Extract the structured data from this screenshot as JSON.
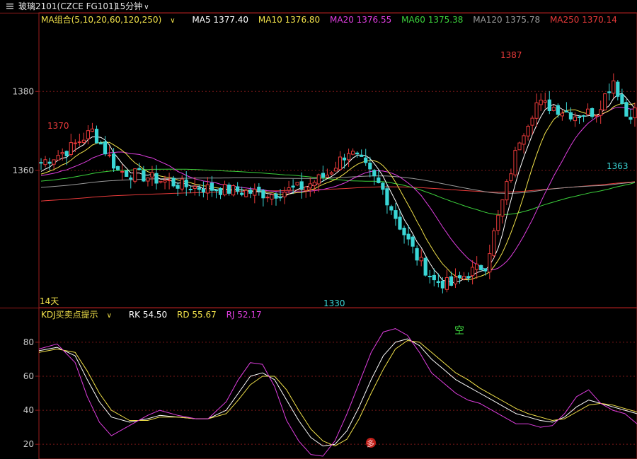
{
  "header": {
    "instrument": "玻璃2101(CZCE FG101)",
    "period": "15分钟"
  },
  "ma_legend": {
    "group_label": "MA组合(5,10,20,60,120,250)",
    "items": [
      {
        "label": "MA5 1377.40",
        "color": "#ffffff"
      },
      {
        "label": "MA10 1376.80",
        "color": "#f2e24a"
      },
      {
        "label": "MA20 1376.55",
        "color": "#e03ee0"
      },
      {
        "label": "MA60 1375.38",
        "color": "#3cd23c"
      },
      {
        "label": "MA120 1375.78",
        "color": "#9a9a9a"
      },
      {
        "label": "MA250 1370.14",
        "color": "#e83a3a"
      }
    ]
  },
  "kdj_legend": {
    "group_label": "KDJ买卖点提示",
    "items": [
      {
        "label": "RK 54.50",
        "color": "#ffffff"
      },
      {
        "label": "RD 55.67",
        "color": "#f2e24a"
      },
      {
        "label": "RJ 52.17",
        "color": "#e03ee0"
      }
    ]
  },
  "annotations": {
    "high_left": "1370",
    "high_right": "1387",
    "low": "1330",
    "low_right": "1363",
    "span": "14天",
    "sell_signal": "空",
    "buy_signal": "多"
  },
  "chart_data": [
    {
      "type": "candlestick",
      "title": "",
      "y_ticks": [
        1380,
        1360
      ],
      "ylim": [
        1327,
        1396
      ],
      "grid": true,
      "n_bars": 140,
      "up_color": "#e83a3a",
      "down_color": "#3ad6d6",
      "key_points": [
        {
          "bar": 0,
          "price": 1362
        },
        {
          "bar": 6,
          "price": 1365
        },
        {
          "bar": 12,
          "price": 1370
        },
        {
          "bar": 18,
          "price": 1360
        },
        {
          "bar": 26,
          "price": 1358
        },
        {
          "bar": 34,
          "price": 1356
        },
        {
          "bar": 44,
          "price": 1355
        },
        {
          "bar": 54,
          "price": 1354
        },
        {
          "bar": 62,
          "price": 1356
        },
        {
          "bar": 67,
          "price": 1359
        },
        {
          "bar": 72,
          "price": 1365
        },
        {
          "bar": 75,
          "price": 1362
        },
        {
          "bar": 80,
          "price": 1355
        },
        {
          "bar": 84,
          "price": 1346
        },
        {
          "bar": 88,
          "price": 1338
        },
        {
          "bar": 92,
          "price": 1332
        },
        {
          "bar": 96,
          "price": 1331
        },
        {
          "bar": 100,
          "price": 1334
        },
        {
          "bar": 104,
          "price": 1336
        },
        {
          "bar": 108,
          "price": 1352
        },
        {
          "bar": 112,
          "price": 1368
        },
        {
          "bar": 116,
          "price": 1377
        },
        {
          "bar": 120,
          "price": 1376
        },
        {
          "bar": 125,
          "price": 1374
        },
        {
          "bar": 130,
          "price": 1375
        },
        {
          "bar": 134,
          "price": 1383
        },
        {
          "bar": 137,
          "price": 1374
        },
        {
          "bar": 139,
          "price": 1375
        }
      ],
      "ma_endpoints": {
        "MA5": 1377.4,
        "MA10": 1376.8,
        "MA20": 1376.55,
        "MA60": 1375.38,
        "MA120": 1375.78,
        "MA250": 1370.14
      }
    },
    {
      "type": "line",
      "title": "",
      "y_ticks": [
        80,
        60,
        40,
        20
      ],
      "ylim": [
        13,
        92
      ],
      "grid": true,
      "x": [
        0,
        6,
        12,
        16,
        20,
        24,
        30,
        36,
        40,
        46,
        52,
        56,
        62,
        66,
        70,
        74,
        78,
        82,
        86,
        90,
        94,
        98,
        102,
        106,
        110,
        114,
        118,
        122,
        126,
        130,
        134,
        138,
        142,
        146,
        150,
        154,
        158,
        162,
        166,
        170,
        174,
        178,
        182,
        186,
        190,
        194,
        198
      ],
      "series": [
        {
          "name": "RK",
          "color": "#ffffff",
          "values": [
            75,
            77,
            72,
            58,
            45,
            36,
            33,
            35,
            37,
            36,
            35,
            35,
            40,
            50,
            60,
            62,
            58,
            46,
            34,
            24,
            19,
            20,
            28,
            42,
            58,
            72,
            80,
            82,
            78,
            70,
            64,
            58,
            54,
            50,
            46,
            42,
            38,
            36,
            34,
            33,
            36,
            42,
            46,
            44,
            42,
            40,
            38
          ]
        },
        {
          "name": "RD",
          "color": "#f2e24a",
          "values": [
            74,
            76,
            74,
            63,
            50,
            40,
            34,
            34,
            36,
            36,
            35,
            35,
            38,
            46,
            55,
            60,
            60,
            52,
            40,
            29,
            22,
            19,
            23,
            35,
            50,
            64,
            76,
            81,
            80,
            74,
            68,
            62,
            58,
            53,
            49,
            45,
            41,
            38,
            36,
            34,
            35,
            39,
            43,
            44,
            43,
            41,
            39
          ]
        },
        {
          "name": "RJ",
          "color": "#e03ee0",
          "values": [
            76,
            79,
            68,
            48,
            33,
            25,
            31,
            37,
            40,
            37,
            35,
            35,
            45,
            58,
            68,
            67,
            54,
            34,
            22,
            14,
            13,
            22,
            38,
            56,
            74,
            86,
            88,
            84,
            74,
            62,
            56,
            50,
            46,
            44,
            40,
            36,
            32,
            32,
            30,
            31,
            38,
            48,
            52,
            44,
            40,
            38,
            32
          ]
        }
      ]
    }
  ]
}
